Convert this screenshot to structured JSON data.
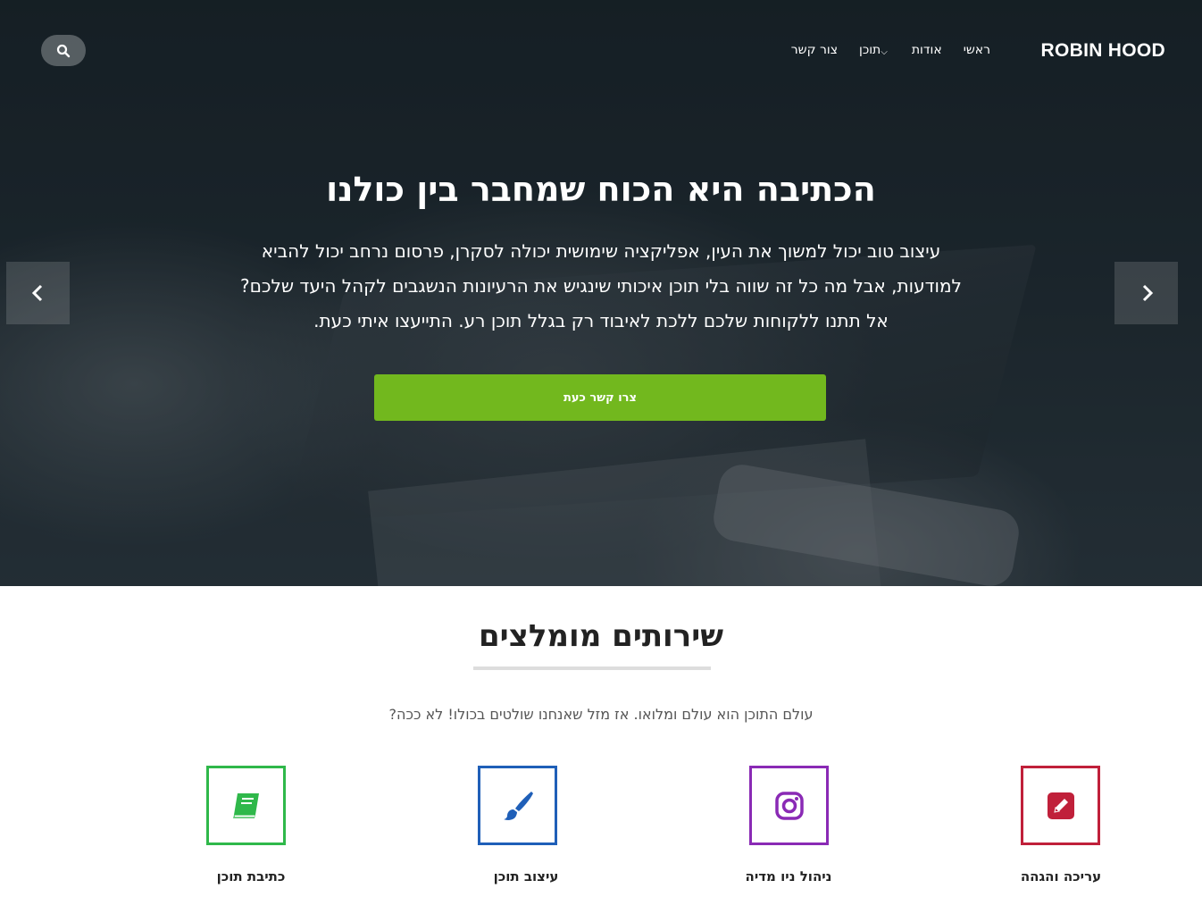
{
  "brand": "ROBIN HOOD",
  "nav": {
    "items": [
      {
        "label": "ראשי"
      },
      {
        "label": "אודות"
      },
      {
        "label": "תוכן",
        "has_dropdown": true
      },
      {
        "label": "צור קשר"
      }
    ],
    "search_icon": "search-icon"
  },
  "hero": {
    "title": "הכתיבה היא הכוח שמחבר בין כולנו",
    "text": "עיצוב טוב יכול למשוך את העין, אפליקציה שימושית יכולה לסקרן, פרסום נרחב יכול להביא למודעות, אבל מה כל זה שווה בלי תוכן איכותי שינגיש את הרעיונות הנשגבים לקהל היעד שלכם? אל תתנו ללקוחות שלכם ללכת לאיבוד רק בגלל תוכן רע. התייעצו איתי כעת.",
    "cta_label": "צרו קשר כעת",
    "cta_color": "#72b81e"
  },
  "services": {
    "title": "שירותים מומלצים",
    "subtitle": "עולם התוכן הוא עולם ומלואו. אז מזל שאנחנו שולטים בכולו! לא ככה?",
    "items": [
      {
        "label": "עריכה והגהה",
        "icon": "pencil-square-icon",
        "color": "#c0203a"
      },
      {
        "label": "ניהול ניו מדיה",
        "icon": "instagram-icon",
        "color": "#8a2ab5"
      },
      {
        "label": "עיצוב תוכן",
        "icon": "paintbrush-icon",
        "color": "#1f5fb8"
      },
      {
        "label": "כתיבת תוכן",
        "icon": "book-icon",
        "color": "#2fb84a"
      }
    ]
  }
}
